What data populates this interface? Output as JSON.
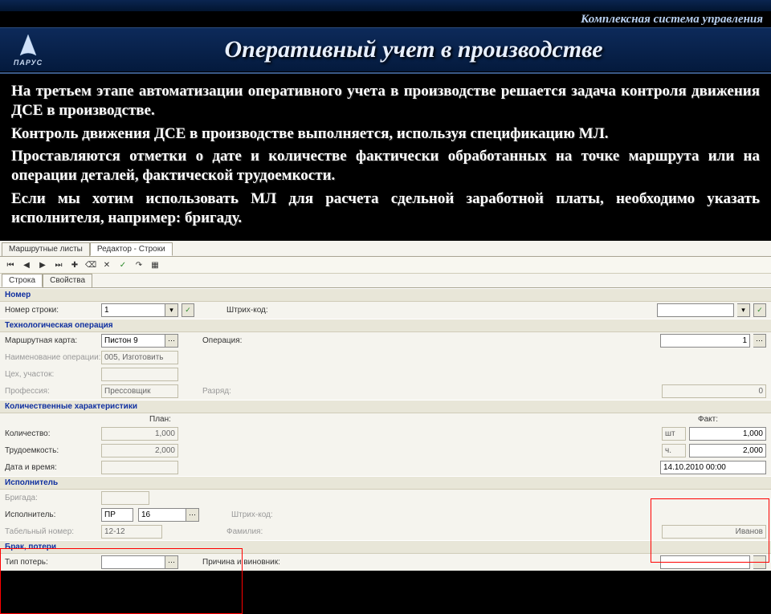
{
  "system_title": "Комплексная система управления",
  "logo_text": "ПАРУС",
  "page_title": "Оперативный учет в производстве",
  "paragraphs": [
    "На третьем этапе автоматизации оперативного учета в производстве решается задача контроля движения ДСЕ в производстве.",
    "Контроль движения ДСЕ в производстве выполняется, используя спецификацию МЛ.",
    "Проставляются отметки о дате и количестве фактически обработанных на точке маршрута или на операции деталей, фактической трудоемкости.",
    "Если мы хотим использовать МЛ для расчета сдельной заработной платы, необходимо указать исполнителя, например: бригаду."
  ],
  "outer_tabs": [
    "Маршрутные листы",
    "Редактор - Строки"
  ],
  "inner_tabs": [
    "Строка",
    "Свойства"
  ],
  "sections": {
    "nomer": "Номер",
    "tech_op": "Технологическая операция",
    "qty": "Количественные характеристики",
    "executor": "Исполнитель",
    "brak": "Брак, потери"
  },
  "labels": {
    "nomer_stroki": "Номер строки:",
    "shtrih_kod": "Штрих-код:",
    "marshrut_karta": "Маршрутная карта:",
    "operatsiya": "Операция:",
    "naimenovanie": "Наименование операции:",
    "tsekh": "Цех, участок:",
    "professiya": "Профессия:",
    "razryad": "Разряд:",
    "plan": "План:",
    "fakt": "Факт:",
    "kolichestvo": "Количество:",
    "trudoemkost": "Трудоемкость:",
    "data_vremya": "Дата и время:",
    "brigada": "Бригада:",
    "ispolnitel": "Исполнитель:",
    "tabel_nomer": "Табельный номер:",
    "familiya": "Фамилия:",
    "tip_poter": "Тип потерь:",
    "prichina": "Причина и виновник:"
  },
  "values": {
    "nomer_stroki": "1",
    "marshrut_karta": "Пистон 9",
    "operatsiya_num": "1",
    "naimenovanie": "005, Изготовить",
    "professiya": "Прессовщик",
    "razryad": "0",
    "plan_kol": "1,000",
    "plan_trud": "2,000",
    "fakt_kol": "1,000",
    "fakt_trud": "2,000",
    "fakt_data": "14.10.2010 00:00",
    "unit_sht": "шт",
    "unit_ch": "ч.",
    "isp_code": "ПР",
    "isp_num": "16",
    "tabel": "12-12",
    "familiya": "Иванов"
  },
  "icons": {
    "dots": "⋯",
    "check": "✓",
    "down": "▾"
  }
}
